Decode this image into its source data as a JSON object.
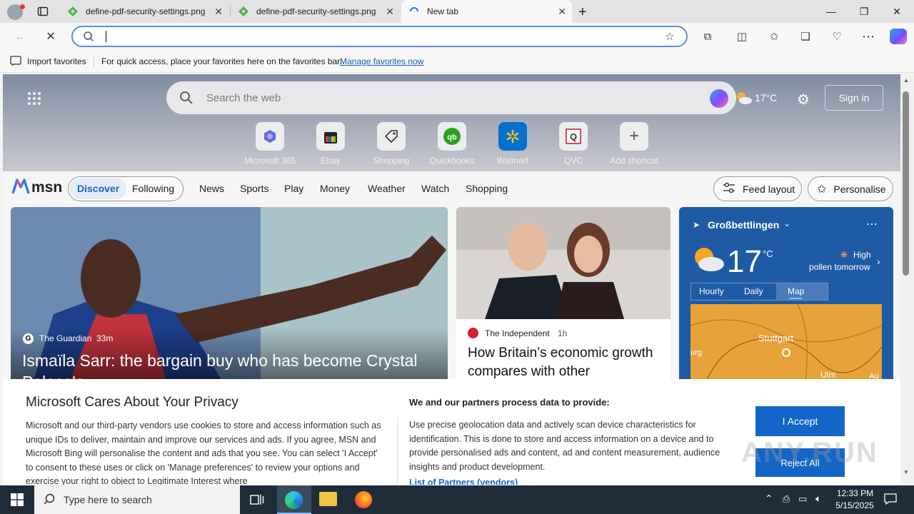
{
  "browser": {
    "tabs": [
      {
        "title": "define-pdf-security-settings.png",
        "active": false
      },
      {
        "title": "define-pdf-security-settings.png",
        "active": false
      },
      {
        "title": "New tab",
        "active": true
      }
    ],
    "address": {
      "value": "",
      "placeholder": ""
    },
    "favorites_bar": {
      "import_label": "Import favorites",
      "message": "For quick access, place your favorites here on the favorites bar.",
      "manage_link": "Manage favorites now"
    }
  },
  "msn": {
    "search_placeholder": "Search the web",
    "weather_mini": "17°C",
    "sign_in": "Sign in",
    "shortcuts": [
      {
        "label": "Microsoft 365",
        "icon": "microsoft365-icon"
      },
      {
        "label": "Ebay",
        "icon": "ebay-icon"
      },
      {
        "label": "Shopping",
        "icon": "shopping-tag-icon"
      },
      {
        "label": "Quickbooks",
        "icon": "quickbooks-icon"
      },
      {
        "label": "Walmart",
        "icon": "walmart-icon"
      },
      {
        "label": "QVC",
        "icon": "qvc-icon"
      },
      {
        "label": "Add shortcut",
        "icon": "plus-icon"
      }
    ],
    "logo_text": "msn",
    "feed_tabs": [
      "Discover",
      "Following"
    ],
    "nav": [
      "News",
      "Sports",
      "Play",
      "Money",
      "Weather",
      "Watch",
      "Shopping"
    ],
    "feed_layout": "Feed layout",
    "personalise": "Personalise",
    "main_story": {
      "source": "The Guardian",
      "age": "33m",
      "headline": "Ismaïla Sarr: the bargain buy who has become Crystal Palace's ..."
    },
    "second_story": {
      "source": "The Independent",
      "age": "1h",
      "headline": "How Britain’s economic growth compares with other"
    },
    "weather": {
      "location": "Großbettlingen",
      "temp": "17",
      "unit": "°C",
      "pollen_level": "High",
      "pollen_when": "pollen tomorrow",
      "tabs": [
        "Hourly",
        "Daily",
        "Map"
      ],
      "map_city_1": "Stuttgart",
      "map_city_2": "Ulm",
      "map_edge_left": "urg",
      "map_edge_right": "Au"
    }
  },
  "privacy": {
    "title": "Microsoft Cares About Your Privacy",
    "body": "Microsoft and our third-party vendors use cookies to store and access information such as unique IDs to deliver, maintain and improve our services and ads. If you agree, MSN and Microsoft Bing will personalise the content and ads that you see. You can select 'I Accept' to consent to these uses or click on 'Manage preferences' to review your options and exercise your right to object to Legitimate Interest where",
    "partners_title": "We and our partners process data to provide:",
    "partners_body": "Use precise geolocation data and actively scan device characteristics for identification. This is done to store and access information on a device and to provide personalised ads and content, ad and content measurement, audience insights and product development.",
    "partners_link": "List of Partners (vendors)",
    "accept": "I Accept",
    "reject": "Reject All"
  },
  "watermark": "ANY.RUN",
  "taskbar": {
    "search_placeholder": "Type here to search",
    "time": "12:33 PM",
    "date": "5/15/2025"
  },
  "colors": {
    "accent": "#1366c7",
    "addr_focus": "#5d8fd8",
    "weather_bg": "#1f5ba5",
    "taskbar": "#1f2c3a"
  }
}
